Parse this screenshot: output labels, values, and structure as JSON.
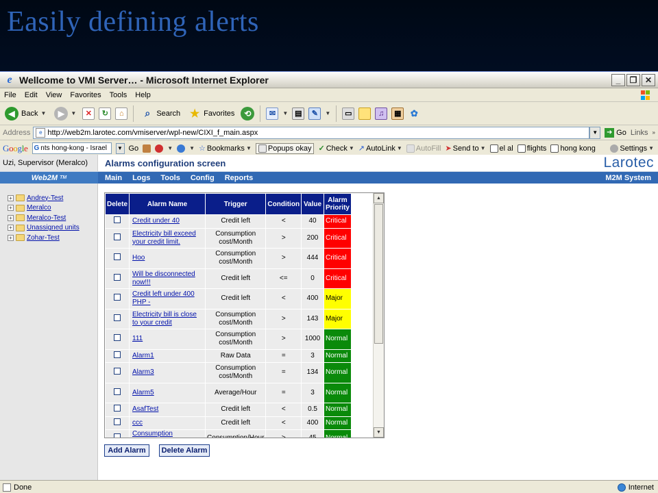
{
  "slide": {
    "title": "Easily defining alerts"
  },
  "window": {
    "title": "Wellcome to VMI Server… - Microsoft Internet Explorer"
  },
  "menu": [
    "File",
    "Edit",
    "View",
    "Favorites",
    "Tools",
    "Help"
  ],
  "toolbar": {
    "back": "Back",
    "search": "Search",
    "favorites": "Favorites"
  },
  "address": {
    "label": "Address",
    "url": "http://web2m.larotec.com/vmiserver/wpl-new/CIXI_f_main.aspx",
    "go": "Go",
    "links": "Links"
  },
  "google": {
    "search_value": "nts hong-kong - Israel",
    "go": "Go",
    "bookmarks": "Bookmarks",
    "popups": "Popups okay",
    "check": "Check",
    "autolink": "AutoLink",
    "autofill": "AutoFill",
    "sendto": "Send to",
    "link1": "el al",
    "link2": "flights",
    "link3": "hong kong",
    "settings": "Settings"
  },
  "page": {
    "user": "Uzi, Supervisor (Meralco)",
    "screen_title": "Alarms configuration screen",
    "brand": "Larotec",
    "web2m": "Web2M",
    "tm": "TM",
    "nav": [
      "Main",
      "Logs",
      "Tools",
      "Config",
      "Reports"
    ],
    "system": "M2M System"
  },
  "tree": [
    "Andrey-Test",
    "Meralco",
    "Meralco-Test",
    "Unassigned units",
    "Zohar-Test"
  ],
  "table": {
    "headers": [
      "Delete",
      "Alarm Name",
      "Trigger",
      "Condition",
      "Value",
      "Alarm Priority"
    ],
    "rows": [
      {
        "name": "Credit under 40",
        "trigger": "Credit left",
        "condition": "<",
        "value": "40",
        "priority": "Critical"
      },
      {
        "name": "Electricity bill exceed your credit limit.",
        "trigger": "Consumption cost/Month",
        "condition": ">",
        "value": "200",
        "priority": "Critical"
      },
      {
        "name": "Hoo",
        "trigger": "Consumption cost/Month",
        "condition": ">",
        "value": "444",
        "priority": "Critical"
      },
      {
        "name": "Will be disconnected now!!!",
        "trigger": "Credit left",
        "condition": "<=",
        "value": "0",
        "priority": "Critical"
      },
      {
        "name": "Credit left under 400 PHP -",
        "trigger": "Credit left",
        "condition": "<",
        "value": "400",
        "priority": "Major"
      },
      {
        "name": "Electricity bill is close to your credit",
        "trigger": "Consumption cost/Month",
        "condition": ">",
        "value": "143",
        "priority": "Major"
      },
      {
        "name": "111",
        "trigger": "Consumption cost/Month",
        "condition": ">",
        "value": "1000",
        "priority": "Normal"
      },
      {
        "name": "Alarm1",
        "trigger": "Raw Data",
        "condition": "=",
        "value": "3",
        "priority": "Normal"
      },
      {
        "name": "Alarm3",
        "trigger": "Consumption cost/Month",
        "condition": "=",
        "value": "134",
        "priority": "Normal"
      },
      {
        "name": "Alarm5",
        "trigger": "Average/Hour",
        "condition": "=",
        "value": "3",
        "priority": "Normal"
      },
      {
        "name": "AsafTest",
        "trigger": "Credit left",
        "condition": "<",
        "value": "0.5",
        "priority": "Normal"
      },
      {
        "name": "ccc",
        "trigger": "Credit left",
        "condition": "<",
        "value": "400",
        "priority": "Normal"
      },
      {
        "name": "Consumption notification",
        "trigger": "Consumption/Hour",
        "condition": ">",
        "value": "45",
        "priority": "Normal"
      }
    ]
  },
  "buttons": {
    "add": "Add Alarm",
    "delete": "Delete Alarm"
  },
  "status": {
    "left": "Done",
    "zone": "Internet"
  }
}
